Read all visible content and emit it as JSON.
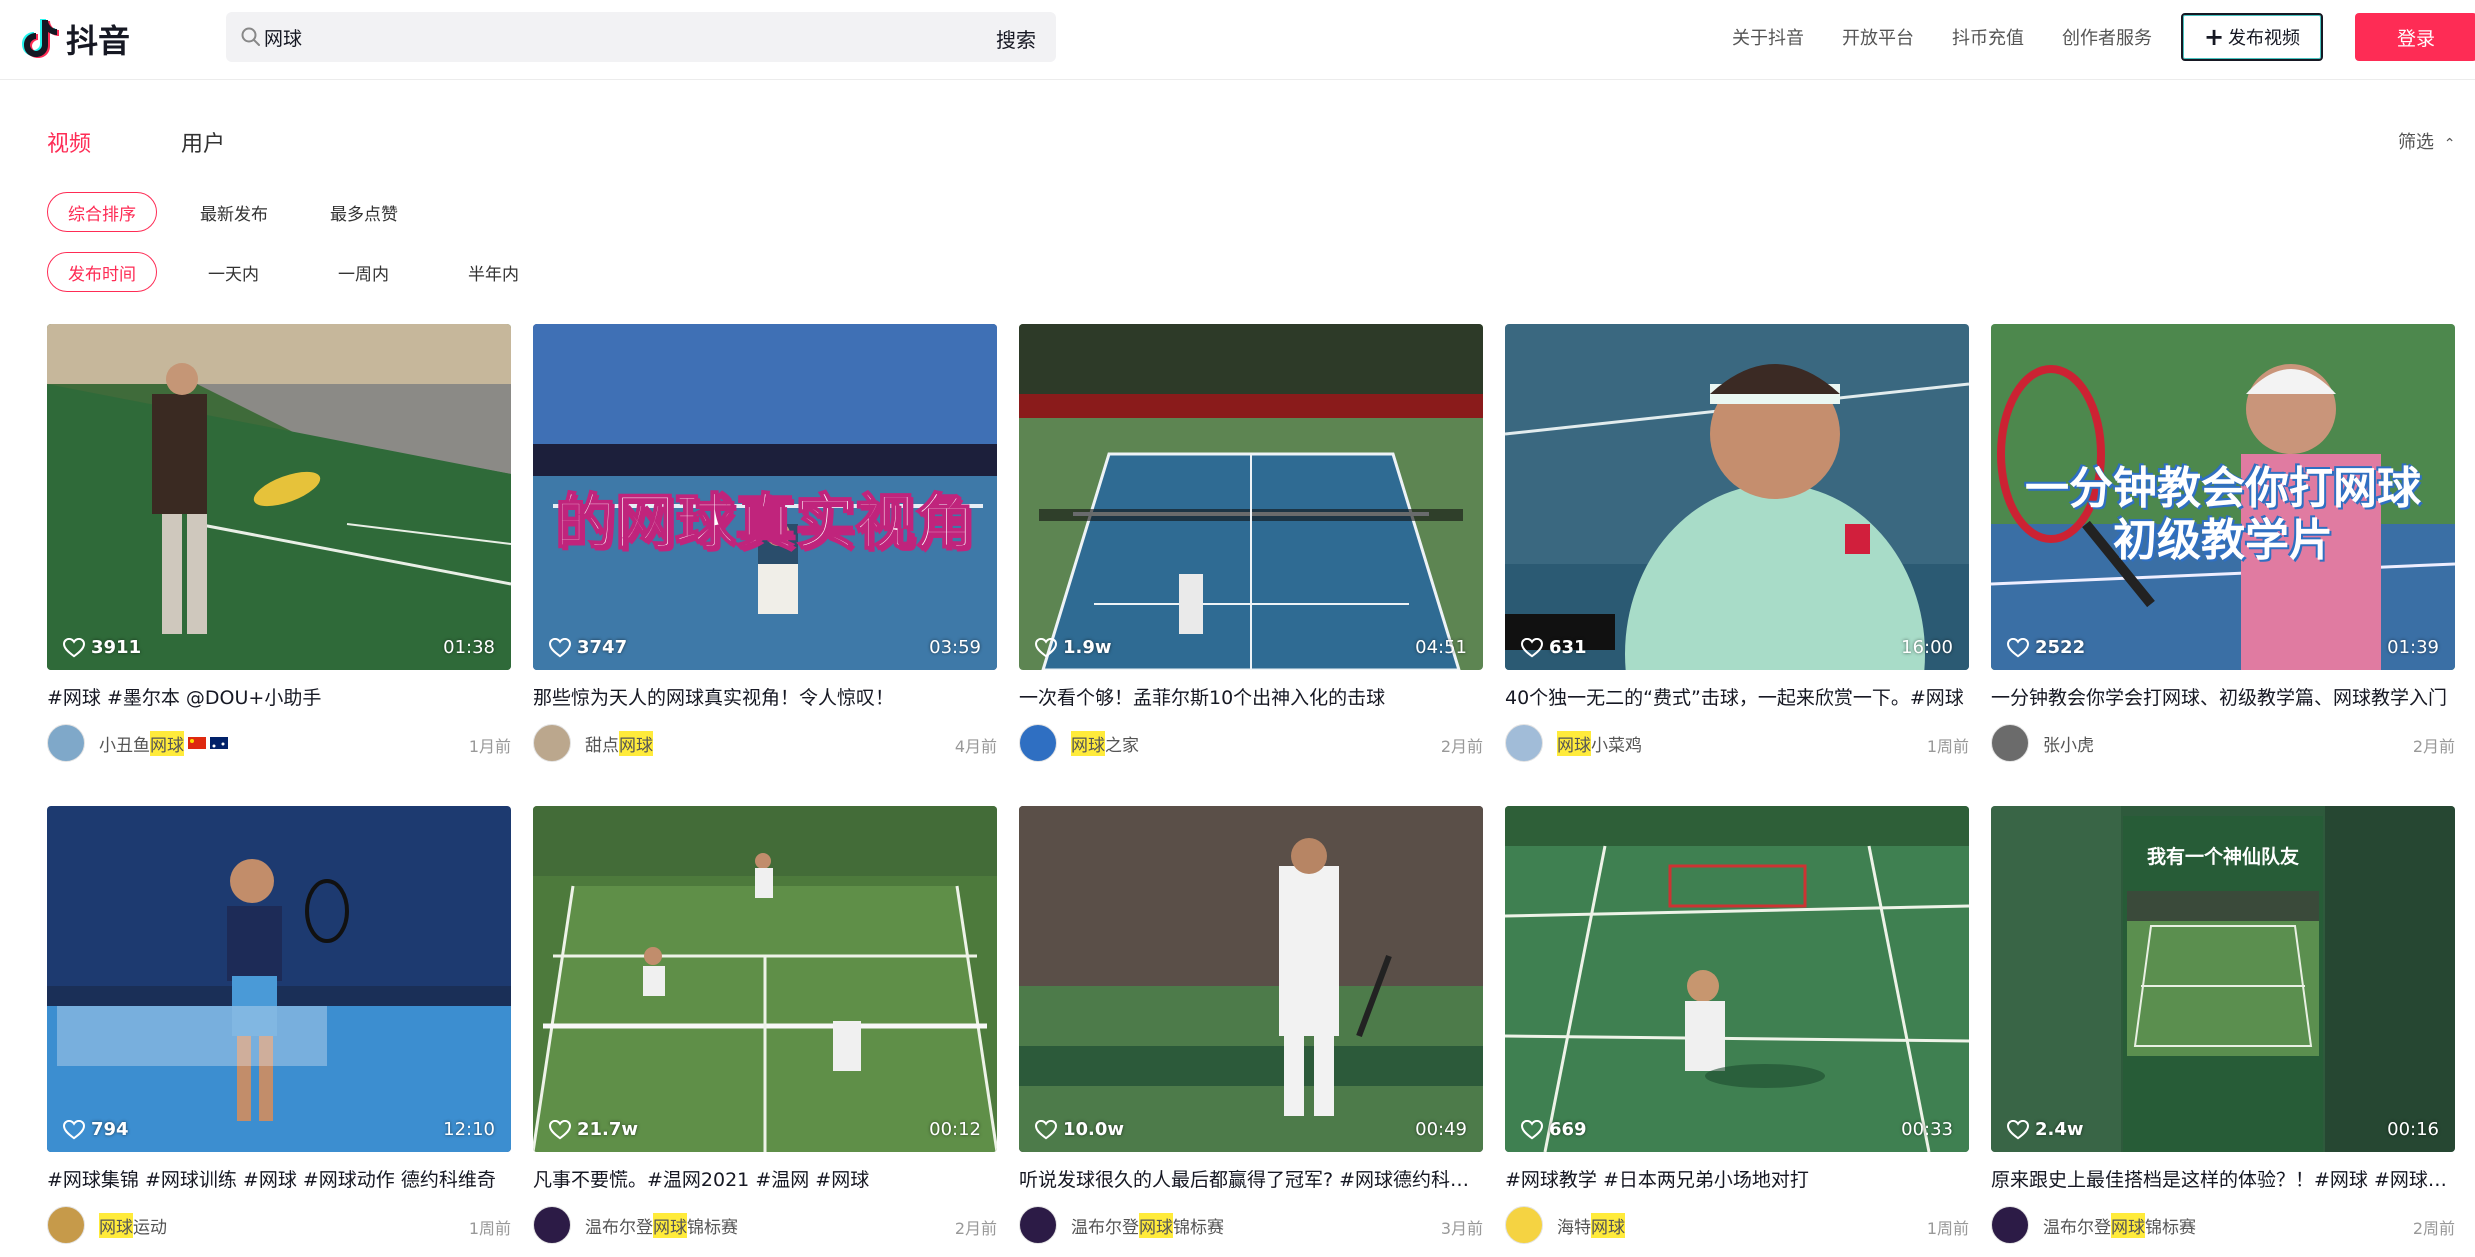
{
  "header": {
    "logo_text": "抖音",
    "search_value": "网球",
    "search_button": "搜索",
    "nav": [
      "关于抖音",
      "开放平台",
      "抖币充值",
      "创作者服务"
    ],
    "upload_label": "发布视频",
    "login_label": "登录"
  },
  "tabs": {
    "video": "视频",
    "user": "用户",
    "filter_toggle": "筛选"
  },
  "sort_chips": [
    "综合排序",
    "最新发布",
    "最多点赞"
  ],
  "time_chips": [
    "发布时间",
    "一天内",
    "一周内",
    "半年内"
  ],
  "accent_color": "#fe2c55",
  "videos": [
    {
      "likes": "3911",
      "duration": "01:38",
      "title": "#网球 #墨尔本 @DOU+小助手",
      "author_pre": "小丑鱼",
      "author_hl": "网球",
      "author_post": "",
      "date": "1月前"
    },
    {
      "likes": "3747",
      "duration": "03:59",
      "title": "那些惊为天人的网球真实视角！令人惊叹！",
      "author_pre": "甜点",
      "author_hl": "网球",
      "author_post": "",
      "date": "4月前",
      "overlay": "的网球真实视角"
    },
    {
      "likes": "1.9w",
      "duration": "04:51",
      "title": "一次看个够！孟菲尔斯10个出神入化的击球",
      "author_pre": "",
      "author_hl": "网球",
      "author_post": "之家",
      "date": "2月前"
    },
    {
      "likes": "631",
      "duration": "16:00",
      "title": "40个独一无二的“费式”击球，一起来欣赏一下。#网球",
      "author_pre": "",
      "author_hl": "网球",
      "author_post": "小菜鸡",
      "date": "1周前"
    },
    {
      "likes": "2522",
      "duration": "01:39",
      "title": "一分钟教会你学会打网球、初级教学篇、网球教学入门",
      "author_pre": "张小虎",
      "author_hl": "",
      "author_post": "",
      "date": "2月前",
      "overlay": "一分钟教会你打网球",
      "overlay2": "初级教学片"
    },
    {
      "likes": "794",
      "duration": "12:10",
      "title": "#网球集锦 #网球训练 #网球 #网球动作 德约科维奇",
      "author_pre": "",
      "author_hl": "网球",
      "author_post": "运动",
      "date": "1周前"
    },
    {
      "likes": "21.7w",
      "duration": "00:12",
      "title": "凡事不要慌。#温网2021 #温网 #网球",
      "author_pre": "温布尔登",
      "author_hl": "网球",
      "author_post": "锦标赛",
      "date": "2月前"
    },
    {
      "likes": "10.0w",
      "duration": "00:49",
      "title": "听说发球很久的人最后都赢得了冠军? #网球德约科维奇",
      "author_pre": "温布尔登",
      "author_hl": "网球",
      "author_post": "锦标赛",
      "date": "3月前"
    },
    {
      "likes": "669",
      "duration": "00:33",
      "title": "#网球教学 #日本两兄弟小场地对打",
      "author_pre": "海特",
      "author_hl": "网球",
      "author_post": "",
      "date": "1周前"
    },
    {
      "likes": "2.4w",
      "duration": "00:16",
      "title": "原来跟史上最佳搭档是这样的体验？！#网球 #网球双打",
      "author_pre": "温布尔登",
      "author_hl": "网球",
      "author_post": "锦标赛",
      "date": "2周前",
      "overlay": "我有一个神仙队友"
    }
  ]
}
